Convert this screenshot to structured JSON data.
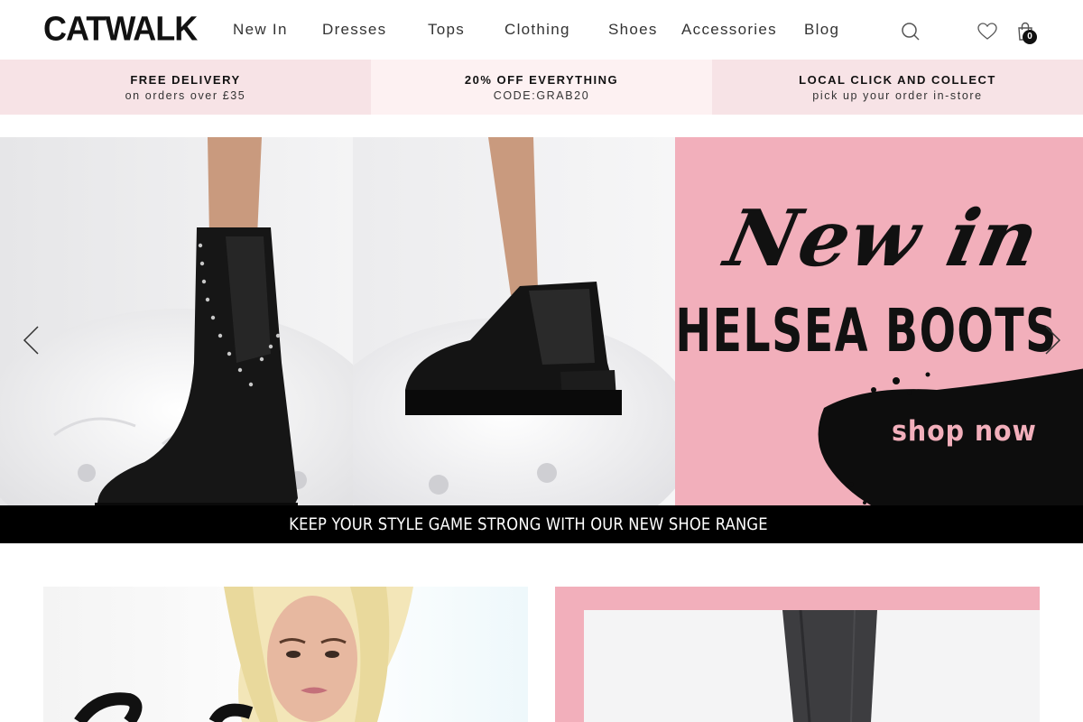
{
  "brand": {
    "logo": "CATWALK"
  },
  "nav": {
    "items": [
      {
        "label": "New In"
      },
      {
        "label": "Dresses"
      },
      {
        "label": "Tops"
      },
      {
        "label": "Clothing"
      },
      {
        "label": "Shoes"
      },
      {
        "label": "Accessories"
      },
      {
        "label": "Blog"
      }
    ]
  },
  "header_icons": {
    "search": "search-icon",
    "wishlist": "heart-icon",
    "cart": "shopping-bag-icon",
    "cart_count": "0"
  },
  "promos": [
    {
      "title": "FREE DELIVERY",
      "subtitle": "on orders over £35",
      "bg": "#f7e3e6"
    },
    {
      "title": "20% OFF EVERYTHING",
      "subtitle": "CODE:GRAB20",
      "bg": "#fdf1f2"
    },
    {
      "title": "LOCAL CLICK AND COLLECT",
      "subtitle": "pick up your order in-store",
      "bg": "#f7e3e6"
    }
  ],
  "hero": {
    "script_title": "New in",
    "headline": "CHELSEA BOOTS",
    "cta": "shop now",
    "banner": "KEEP YOUR  STYLE GAME STRONG WITH OUR NEW SHOE RANGE",
    "prev_icon": "chevron-left-icon",
    "next_icon": "chevron-right-icon"
  },
  "colors": {
    "accent_pink": "#f2afbb",
    "black": "#000000"
  }
}
